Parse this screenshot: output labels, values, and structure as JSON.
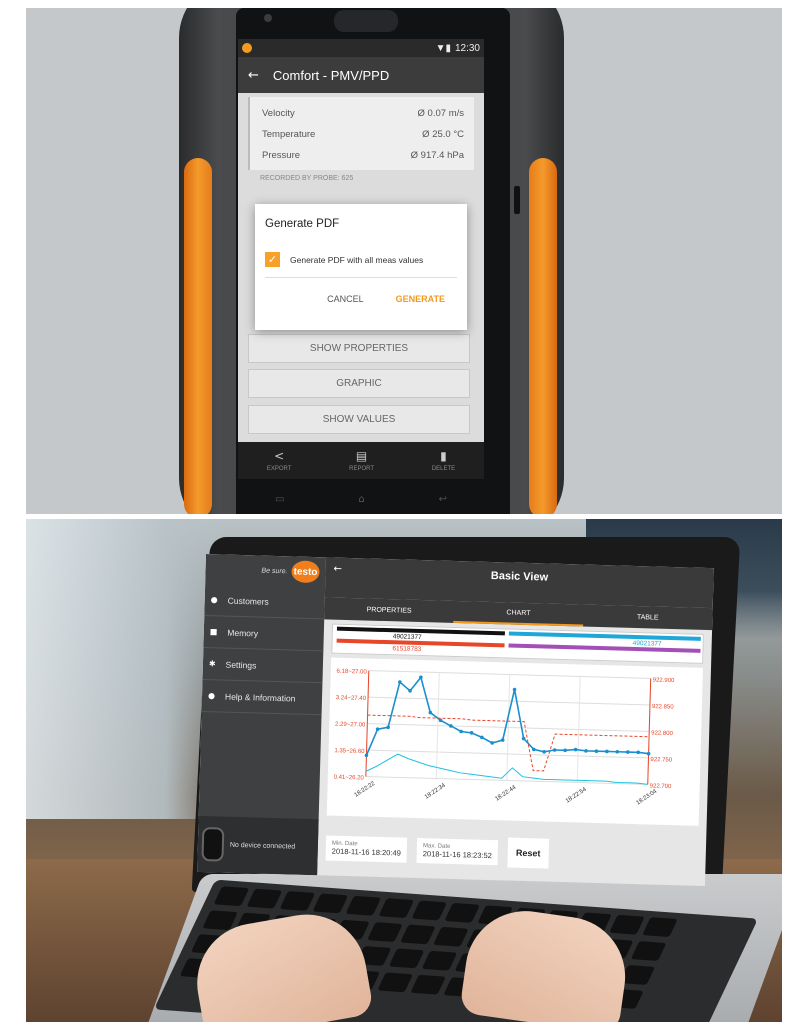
{
  "phone": {
    "status_time": "12:30",
    "title": "Comfort - PMV/PPD",
    "measurements": [
      {
        "label": "Velocity",
        "value": "Ø 0.07 m/s"
      },
      {
        "label": "Temperature",
        "value": "Ø 25.0 °C"
      },
      {
        "label": "Pressure",
        "value": "Ø 917.4 hPa"
      }
    ],
    "recorded_by": "RECORDED BY PROBE:  625",
    "dialog": {
      "title": "Generate PDF",
      "checkbox_label": "Generate PDF with all meas values",
      "checkbox_checked": true,
      "cancel": "CANCEL",
      "generate": "GENERATE"
    },
    "buttons": {
      "show_properties": "SHOW PROPERTIES",
      "graphic": "GRAPHIC",
      "show_values": "SHOW VALUES"
    },
    "nav": {
      "export": "EXPORT",
      "report": "REPORT",
      "delete": "DELETE"
    },
    "accent": "#f39a1e"
  },
  "laptop": {
    "brand_tag": "Be sure.",
    "brand_logo": "testo",
    "sidebar": [
      {
        "label": "Customers",
        "icon": "person-icon"
      },
      {
        "label": "Memory",
        "icon": "memory-icon"
      },
      {
        "label": "Settings",
        "icon": "gear-icon"
      },
      {
        "label": "Help & Information",
        "icon": "info-icon"
      }
    ],
    "device_status": "No device connected",
    "header_title": "Basic View",
    "tabs": [
      {
        "label": "PROPERTIES",
        "active": false
      },
      {
        "label": "CHART",
        "active": true
      },
      {
        "label": "TABLE",
        "active": false
      }
    ],
    "legend": [
      {
        "id": "49021377",
        "color": "#111111"
      },
      {
        "id": "61518783",
        "color": "#e8462a"
      },
      {
        "id": "49021377",
        "color": "#1fa7d8"
      }
    ],
    "min_date_label": "Min. Date",
    "min_date": "2018-11-16 18:20:49",
    "max_date_label": "Max. Date",
    "max_date": "2018-11-16 18:23:52",
    "reset": "Reset"
  },
  "chart_data": {
    "type": "line",
    "x": [
      "18:22:22",
      "18:22:34",
      "18:22:44",
      "18:22:54",
      "18:23:04"
    ],
    "y_left_ticks": [
      "6.18~27.00",
      "3.24~27.40",
      "2.29~27.00",
      "1.35~26.60",
      "0.41~26.20"
    ],
    "y_right_ticks": [
      "922.900",
      "922.850",
      "922.800",
      "922.750",
      "922.700"
    ],
    "series": [
      {
        "color": "#1a8fd0",
        "values": [
          0.2,
          0.45,
          0.47,
          0.9,
          0.82,
          0.95,
          0.62,
          0.55,
          0.5,
          0.45,
          0.44,
          0.4,
          0.35,
          0.38,
          0.86,
          0.4,
          0.3,
          0.28,
          0.3,
          0.3,
          0.31,
          0.3,
          0.3,
          0.3,
          0.3,
          0.3,
          0.3,
          0.29
        ]
      },
      {
        "color": "#1fc3e0",
        "values": [
          0.05,
          0.1,
          0.16,
          0.22,
          0.18,
          0.15,
          0.12,
          0.1,
          0.08,
          0.06,
          0.05,
          0.04,
          0.03,
          0.02,
          0.12,
          0.04,
          0.03,
          0.02,
          0.02,
          0.02,
          0.02,
          0.02,
          0.02,
          0.02,
          0.01,
          0.01,
          0.01,
          0.0
        ]
      },
      {
        "color": "#e8462a",
        "values": [
          0.58,
          0.58,
          0.58,
          0.58,
          0.58,
          0.57,
          0.57,
          0.57,
          0.57,
          0.57,
          0.56,
          0.56,
          0.56,
          0.56,
          0.56,
          0.56,
          0.1,
          0.1,
          0.45,
          0.45,
          0.45,
          0.45,
          0.45,
          0.45,
          0.45,
          0.45,
          0.45,
          0.45
        ]
      }
    ]
  }
}
